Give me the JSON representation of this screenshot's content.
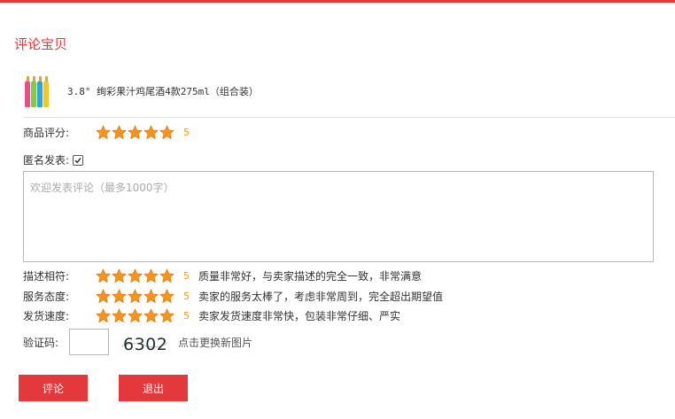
{
  "page_title": "评论宝贝",
  "product": {
    "name": "3.8° 绚彩果汁鸡尾酒4款275ml（组合装）",
    "thumb_colors": [
      "#e84c8a",
      "#8cc63f",
      "#2ba6de",
      "#f3c623"
    ]
  },
  "rating": {
    "label": "商品评分:",
    "score": "5",
    "stars": 5,
    "max_stars": 5,
    "star_color": "#f7941d"
  },
  "anonymous": {
    "label": "匿名发表:",
    "checked": true
  },
  "comment": {
    "placeholder": "欢迎发表评论（最多1000字）",
    "value": ""
  },
  "detail_ratings": [
    {
      "label": "描述相符:",
      "score": "5",
      "stars": 5,
      "desc": "质量非常好，与卖家描述的完全一致，非常满意"
    },
    {
      "label": "服务态度:",
      "score": "5",
      "stars": 5,
      "desc": "卖家的服务太棒了，考虑非常周到，完全超出期望值"
    },
    {
      "label": "发货速度:",
      "score": "5",
      "stars": 5,
      "desc": "卖家发货速度非常快，包装非常仔细、严实"
    }
  ],
  "captcha": {
    "label": "验证码:",
    "image_text": "6302",
    "refresh_label": "点击更换新图片",
    "value": ""
  },
  "buttons": {
    "submit": "评论",
    "exit": "退出"
  },
  "colors": {
    "accent": "#e4393c",
    "score": "#f19a12"
  }
}
